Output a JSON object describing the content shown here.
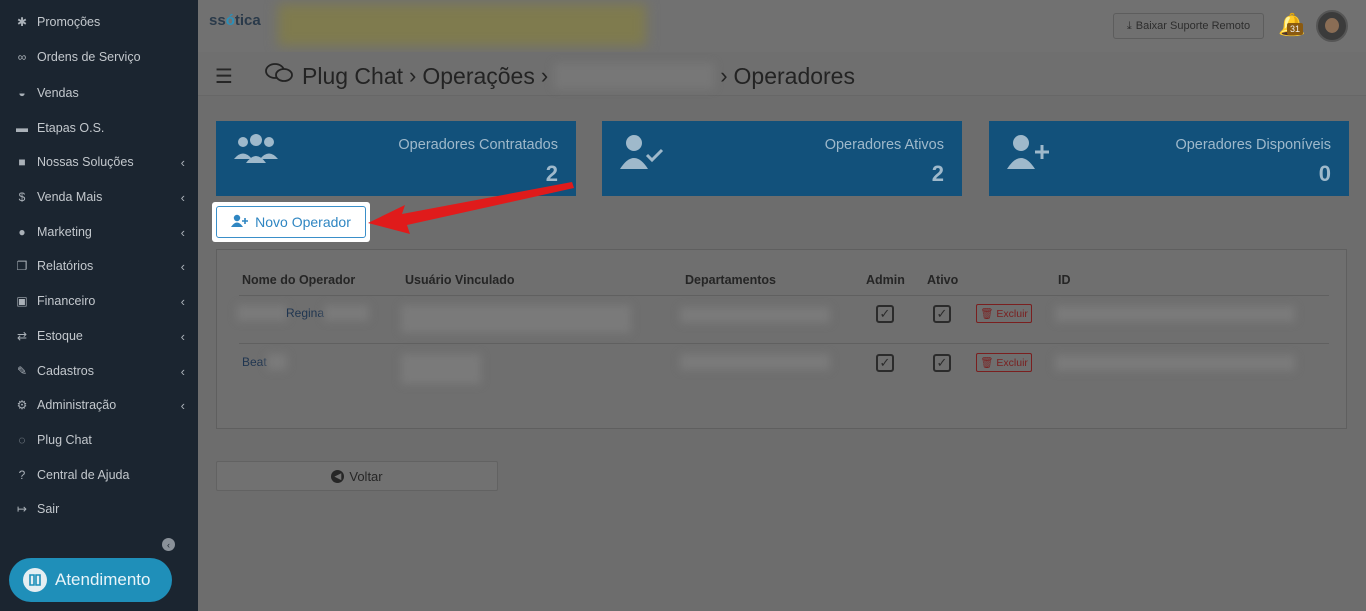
{
  "sidebar": {
    "items": [
      {
        "label": "Promoções",
        "icon": "asterisk-icon",
        "has_children": false
      },
      {
        "label": "Ordens de Serviço",
        "icon": "glasses-icon",
        "has_children": false
      },
      {
        "label": "Vendas",
        "icon": "basket-icon",
        "has_children": false
      },
      {
        "label": "Etapas O.S.",
        "icon": "card-icon",
        "has_children": false
      },
      {
        "label": "Nossas Soluções",
        "icon": "briefcase-icon",
        "has_children": true
      },
      {
        "label": "Venda Mais",
        "icon": "dollar-icon",
        "has_children": true
      },
      {
        "label": "Marketing",
        "icon": "comments-icon",
        "has_children": true
      },
      {
        "label": "Relatórios",
        "icon": "copy-icon",
        "has_children": true
      },
      {
        "label": "Financeiro",
        "icon": "money-icon",
        "has_children": true
      },
      {
        "label": "Estoque",
        "icon": "exchange-icon",
        "has_children": true
      },
      {
        "label": "Cadastros",
        "icon": "edit-icon",
        "has_children": true
      },
      {
        "label": "Administração",
        "icon": "cogs-icon",
        "has_children": true
      },
      {
        "label": "Plug Chat",
        "icon": "chat-icon",
        "has_children": false
      },
      {
        "label": "Central de Ajuda",
        "icon": "question-icon",
        "has_children": false
      },
      {
        "label": "Sair",
        "icon": "sign-out-icon",
        "has_children": false
      }
    ],
    "atendimento_label": "Atendimento"
  },
  "header": {
    "logo_text_pre": "ss",
    "logo_text_o": "ó",
    "logo_text_post": "tica",
    "suporte_label": "Baixar Suporte Remoto",
    "notification_count": "31"
  },
  "breadcrumb": {
    "items": [
      "Plug Chat",
      "Operações",
      "Operadores"
    ]
  },
  "cards": [
    {
      "label": "Operadores Contratados",
      "value": "2",
      "icon": "users-icon"
    },
    {
      "label": "Operadores Ativos",
      "value": "2",
      "icon": "user-check-icon"
    },
    {
      "label": "Operadores Disponíveis",
      "value": "0",
      "icon": "user-plus-icon"
    }
  ],
  "novo_operador_label": "Novo Operador",
  "table": {
    "headers": [
      "Nome do Operador",
      "Usuário Vinculado",
      "Departamentos",
      "Admin",
      "Ativo",
      "ID"
    ],
    "rows": [
      {
        "name": "Regina",
        "admin": true,
        "ativo": true,
        "delete_label": "Excluir"
      },
      {
        "name": "Beat",
        "admin": true,
        "ativo": true,
        "delete_label": "Excluir"
      }
    ]
  },
  "voltar_label": "Voltar",
  "colors": {
    "sidebar_bg": "#1b2530",
    "card_bg": "#12517b",
    "accent": "#2f86c2",
    "arrow": "#e01b1b",
    "danger": "#7a1f1f"
  }
}
